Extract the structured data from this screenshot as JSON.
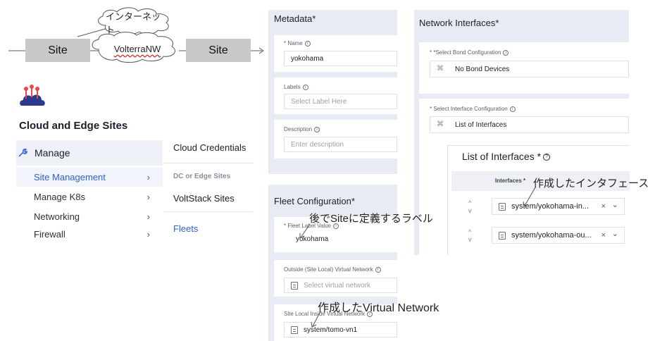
{
  "diagram": {
    "site_left": "Site",
    "site_right": "Site",
    "cloud_internet": "インターネット",
    "cloud_volterra": "VolterraNW"
  },
  "nav": {
    "title": "Cloud and Edge Sites",
    "manage_label": "Manage",
    "items": [
      {
        "label": "Site Management",
        "chev": "›"
      },
      {
        "label": "Manage K8s",
        "chev": "›"
      },
      {
        "label": "Networking",
        "chev": "›"
      },
      {
        "label": "Firewall",
        "chev": "›"
      }
    ],
    "submenu": {
      "cloud_credentials": "Cloud Credentials",
      "section_header": "DC or Edge Sites",
      "voltstack": "VoltStack Sites",
      "fleets": "Fleets"
    }
  },
  "metadata": {
    "title": "Metadata*",
    "name_label": "* Name",
    "name_value": "yokohama",
    "labels_label": "Labels",
    "labels_placeholder": "Select Label Here",
    "description_label": "Description",
    "description_placeholder": "Enter description"
  },
  "fleet": {
    "title": "Fleet Configuration*",
    "label_value_label": "* Fleet Label Value",
    "label_value": "yokohama",
    "outside_label": "Outside (Site Local) Virtual Network",
    "outside_placeholder": "Select virtual network",
    "inside_label": "Site Local Inside Virtual Network",
    "inside_value": "system/tomo-vn1"
  },
  "network": {
    "title": "Network Interfaces*",
    "bond_label": "* *Select Bond Configuration",
    "bond_value": "No Bond Devices",
    "iface_config_label": "* Select Interface Configuration",
    "iface_config_value": "List of Interfaces",
    "list_title": "List of Interfaces *",
    "col_header": "Interfaces *",
    "rows": [
      {
        "value": "system/yokohama-in...",
        "up": "^",
        "down": "v",
        "clear": "×",
        "dropdown": "⌄"
      },
      {
        "value": "system/yokohama-ou...",
        "up": "^",
        "down": "v",
        "clear": "×",
        "dropdown": "⌄"
      }
    ]
  },
  "annotations": {
    "site_label": "後でSiteに定義するラベル",
    "interface": "作成したインタフェース",
    "virtual_network": "作成したVirtual Network"
  },
  "icons": {
    "wrench": "wrench-icon",
    "cloud_logo": "cloud-edge-icon",
    "info": "info-icon",
    "doc": "document-icon",
    "bond": "bond-icon"
  },
  "colors": {
    "accent": "#2f5fd0",
    "panel": "#e8ebf4",
    "site_box": "#c8c8c8",
    "logo": "#e8484a"
  }
}
